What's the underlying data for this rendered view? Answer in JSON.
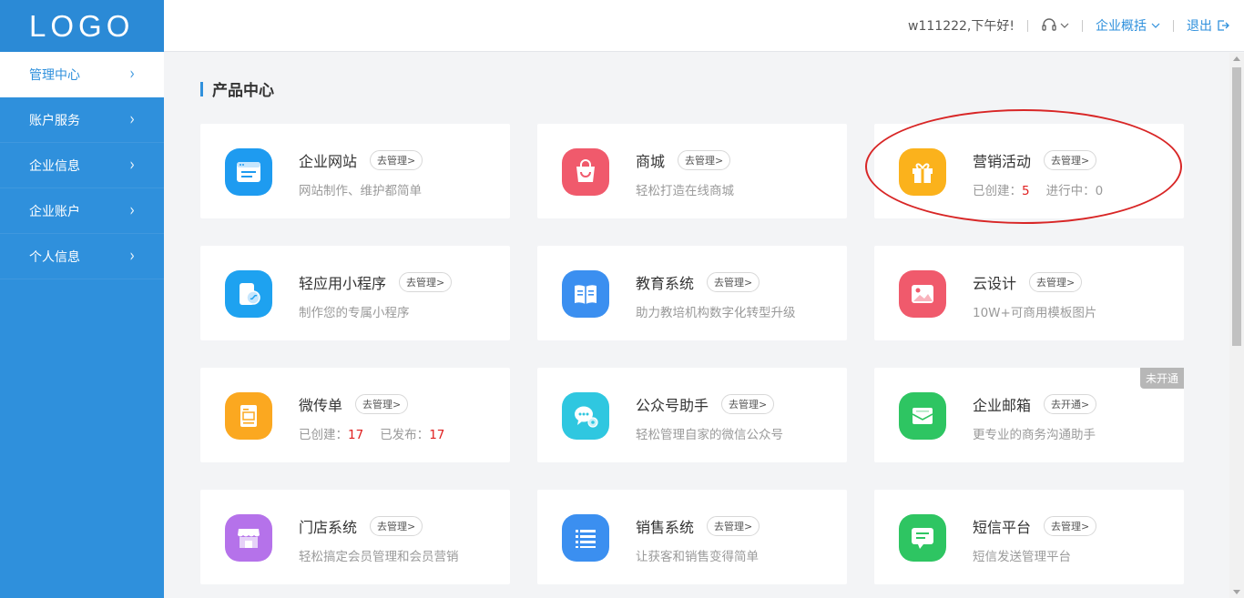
{
  "logo": "LOGO",
  "sidebar": {
    "items": [
      {
        "label": "管理中心",
        "active": true
      },
      {
        "label": "账户服务"
      },
      {
        "label": "企业信息"
      },
      {
        "label": "企业账户"
      },
      {
        "label": "个人信息"
      }
    ]
  },
  "header": {
    "greeting": "w111222,下午好!",
    "support_icon": "headset-icon",
    "overview_label": "企业概括",
    "logout_label": "退出"
  },
  "section_title": "产品中心",
  "products": [
    {
      "name": "企业网站",
      "button": "去管理>",
      "desc": "网站制作、维护都简单",
      "icon": "website-icon",
      "color": "#1e9bf0"
    },
    {
      "name": "商城",
      "button": "去管理>",
      "desc": "轻松打造在线商城",
      "icon": "shopping-bag-icon",
      "color": "#f05a6c"
    },
    {
      "name": "营销活动",
      "button": "去管理>",
      "desc_prefix": "已创建：",
      "created": "5",
      "desc_mid": "进行中：",
      "ongoing": "0",
      "icon": "gift-icon",
      "color": "#fbb21c"
    },
    {
      "name": "轻应用小程序",
      "button": "去管理>",
      "desc": "制作您的专属小程序",
      "icon": "mini-program-icon",
      "color": "#1ea2f0"
    },
    {
      "name": "教育系统",
      "button": "去管理>",
      "desc": "助力教培机构数字化转型升级",
      "icon": "book-icon",
      "color": "#3b8ff0"
    },
    {
      "name": "云设计",
      "button": "去管理>",
      "desc": "10W+可商用模板图片",
      "icon": "image-icon",
      "color": "#f05a6c"
    },
    {
      "name": "微传单",
      "button": "去管理>",
      "desc_prefix": "已创建：",
      "created": "17",
      "desc_mid": "已发布：",
      "published": "17",
      "icon": "flyer-icon",
      "color": "#fba820"
    },
    {
      "name": "公众号助手",
      "button": "去管理>",
      "desc": "轻松管理自家的微信公众号",
      "icon": "wechat-icon",
      "color": "#2fc7e0"
    },
    {
      "name": "企业邮箱",
      "button": "去开通>",
      "desc": "更专业的商务沟通助手",
      "badge": "未开通",
      "icon": "mail-icon",
      "color": "#2ec562"
    },
    {
      "name": "门店系统",
      "button": "去管理>",
      "desc": "轻松搞定会员管理和会员营销",
      "icon": "store-icon",
      "color": "#b572ea"
    },
    {
      "name": "销售系统",
      "button": "去管理>",
      "desc": "让获客和销售变得简单",
      "icon": "list-icon",
      "color": "#3b8ff0"
    },
    {
      "name": "短信平台",
      "button": "去管理>",
      "desc": "短信发送管理平台",
      "icon": "sms-icon",
      "color": "#2ec562"
    }
  ]
}
